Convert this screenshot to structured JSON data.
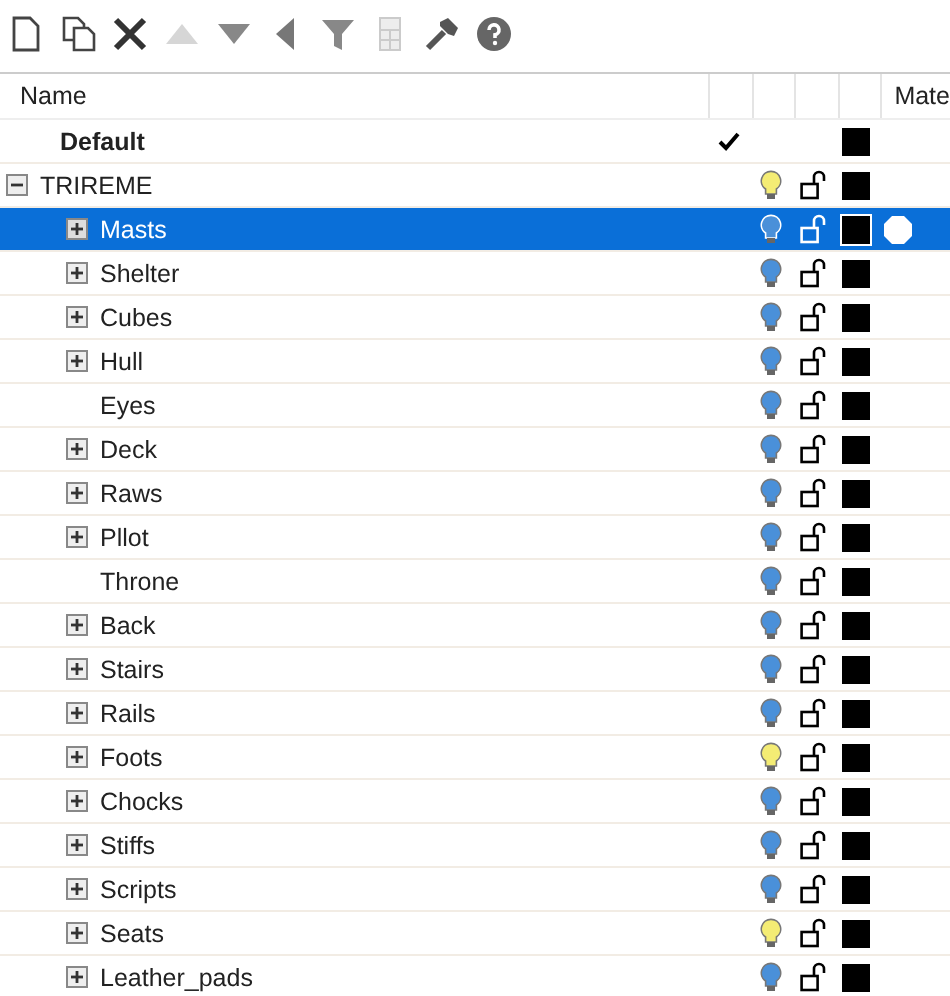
{
  "toolbar": [
    {
      "kind": "new",
      "disabled": false
    },
    {
      "kind": "copy",
      "disabled": false
    },
    {
      "kind": "delete",
      "disabled": false
    },
    {
      "kind": "up",
      "disabled": true
    },
    {
      "kind": "down",
      "disabled": false
    },
    {
      "kind": "left",
      "disabled": false
    },
    {
      "kind": "filter",
      "disabled": false
    },
    {
      "kind": "grid",
      "disabled": true
    },
    {
      "kind": "tools",
      "disabled": false
    },
    {
      "kind": "help",
      "disabled": false
    }
  ],
  "columns": {
    "name": "Name",
    "column_6": "Mate"
  },
  "layers": [
    {
      "name": "Default",
      "current": true,
      "selected": false
    },
    {
      "name": "TRIREME",
      "current": false,
      "selected": false,
      "expanded": true,
      "bulb_lit": true,
      "locked": false,
      "children": [
        {
          "name": "Masts",
          "current": false,
          "selected": true,
          "expanded": false,
          "bulb_lit": false,
          "locked": false
        },
        {
          "name": "Shelter",
          "current": false,
          "selected": false,
          "expanded": false,
          "bulb_lit": false,
          "locked": false
        },
        {
          "name": "Cubes",
          "current": false,
          "selected": false,
          "expanded": false,
          "bulb_lit": false,
          "locked": false
        },
        {
          "name": "Hull",
          "current": false,
          "selected": false,
          "expanded": false,
          "bulb_lit": false,
          "locked": false
        },
        {
          "name": "Eyes",
          "current": false,
          "selected": false,
          "bulb_lit": false,
          "locked": false
        },
        {
          "name": "Deck",
          "current": false,
          "selected": false,
          "expanded": false,
          "bulb_lit": false,
          "locked": false
        },
        {
          "name": "Raws",
          "current": false,
          "selected": false,
          "expanded": false,
          "bulb_lit": false,
          "locked": false
        },
        {
          "name": "Pllot",
          "current": false,
          "selected": false,
          "expanded": false,
          "bulb_lit": false,
          "locked": false
        },
        {
          "name": "Throne",
          "current": false,
          "selected": false,
          "bulb_lit": false,
          "locked": false
        },
        {
          "name": "Back",
          "current": false,
          "selected": false,
          "expanded": false,
          "bulb_lit": false,
          "locked": false
        },
        {
          "name": "Stairs",
          "current": false,
          "selected": false,
          "expanded": false,
          "bulb_lit": false,
          "locked": false
        },
        {
          "name": "Rails",
          "current": false,
          "selected": false,
          "expanded": false,
          "bulb_lit": false,
          "locked": false
        },
        {
          "name": "Foots",
          "current": false,
          "selected": false,
          "expanded": false,
          "bulb_lit": true,
          "locked": false
        },
        {
          "name": "Chocks",
          "current": false,
          "selected": false,
          "expanded": false,
          "bulb_lit": false,
          "locked": false
        },
        {
          "name": "Stiffs",
          "current": false,
          "selected": false,
          "expanded": false,
          "bulb_lit": false,
          "locked": false
        },
        {
          "name": "Scripts",
          "current": false,
          "selected": false,
          "expanded": false,
          "bulb_lit": false,
          "locked": false
        },
        {
          "name": "Seats",
          "current": false,
          "selected": false,
          "expanded": false,
          "bulb_lit": true,
          "locked": false
        },
        {
          "name": "Leather_pads",
          "current": false,
          "selected": false,
          "expanded": false,
          "bulb_lit": false,
          "locked": false
        }
      ]
    }
  ]
}
